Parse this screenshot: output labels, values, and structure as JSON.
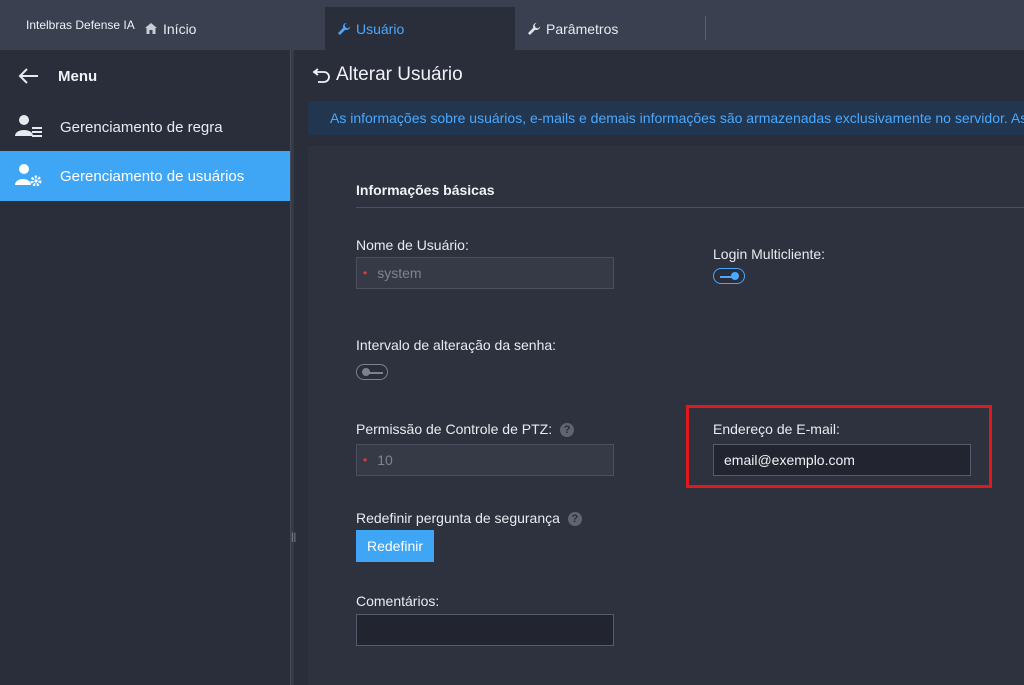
{
  "topbar": {
    "brand": "Intelbras Defense IA",
    "tabs": [
      {
        "label": "Início",
        "icon": "home-icon"
      },
      {
        "label": "Usuário",
        "icon": "wrench-icon"
      },
      {
        "label": "Parâmetros",
        "icon": "wrench-icon"
      }
    ],
    "active_tab": "Usuário"
  },
  "sidebar": {
    "menu_label": "Menu",
    "items": [
      {
        "label": "Gerenciamento de regra",
        "icon": "user-list-icon"
      },
      {
        "label": "Gerenciamento de usuários",
        "icon": "user-gear-icon",
        "active": true
      }
    ]
  },
  "main": {
    "title": "Alterar Usuário",
    "info": "As informações sobre usuários, e-mails e demais informações são armazenadas exclusivamente no servidor. As in",
    "section_title": "Informações básicas",
    "fields": {
      "username": {
        "label": "Nome de Usuário:",
        "value": "system"
      },
      "multiclient": {
        "label": "Login Multicliente:",
        "enabled": true
      },
      "password_interval": {
        "label": "Intervalo de alteração da senha:",
        "enabled": false
      },
      "ptz": {
        "label": "Permissão de Controle de PTZ:",
        "value": "10"
      },
      "email": {
        "label": "Endereço de E-mail:",
        "value": "email@exemplo.com"
      },
      "security_question": {
        "label": "Redefinir pergunta de segurança",
        "button": "Redefinir"
      },
      "comments": {
        "label": "Comentários:",
        "value": ""
      }
    },
    "help_symbol": "?"
  },
  "colors": {
    "accent": "#3fa6f5",
    "highlight": "#e0191f",
    "required": "#e03a3a"
  }
}
